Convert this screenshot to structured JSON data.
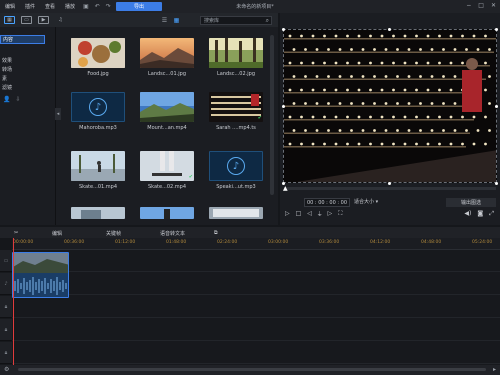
{
  "menu": [
    "编辑",
    "插件",
    "查看",
    "播放"
  ],
  "toolbar": {
    "export_label": "导出"
  },
  "project_title": "未命名的新项目*",
  "library": {
    "tabs": [
      "media-icon",
      "image-icon",
      "video-icon",
      "audio-icon"
    ],
    "search_placeholder": "搜索库",
    "sidebar": [
      "内容",
      "效果",
      "转场",
      "素",
      "滤镜"
    ],
    "items": [
      {
        "label": "Food.jpg",
        "kind": "image"
      },
      {
        "label": "Landsc...01.jpg",
        "kind": "image"
      },
      {
        "label": "Landsc...02.jpg",
        "kind": "image"
      },
      {
        "label": "Mahoroba.mp3",
        "kind": "audio"
      },
      {
        "label": "Mount...an.mp4",
        "kind": "video"
      },
      {
        "label": "Sarah ....mp4.ts",
        "kind": "video",
        "checked": true
      },
      {
        "label": "Skate...01.mp4",
        "kind": "video"
      },
      {
        "label": "Skate...02.mp4",
        "kind": "video",
        "checked": true
      },
      {
        "label": "Speaki...ut.mp3",
        "kind": "audio"
      },
      {
        "label": "",
        "kind": "video"
      },
      {
        "label": "",
        "kind": "video"
      },
      {
        "label": "",
        "kind": "video"
      }
    ]
  },
  "preview": {
    "timecode": "00 : 00 : 00 : 00",
    "ratio_label": "适合大小 ▾",
    "hq_label": "输出图选"
  },
  "timeline": {
    "tools": [
      "编辑",
      "关键帧",
      "语音转文本"
    ],
    "ruler": [
      "00:00:00",
      "00:36:00",
      "01:12:00",
      "01:48:00",
      "02:24:00",
      "03:00:00",
      "03:36:00",
      "04:12:00",
      "04:48:00",
      "05:24:00"
    ]
  },
  "colors": {
    "accent": "#3c7de6",
    "playhead": "#e03c3c",
    "ruler_text": "#b28a3c"
  }
}
